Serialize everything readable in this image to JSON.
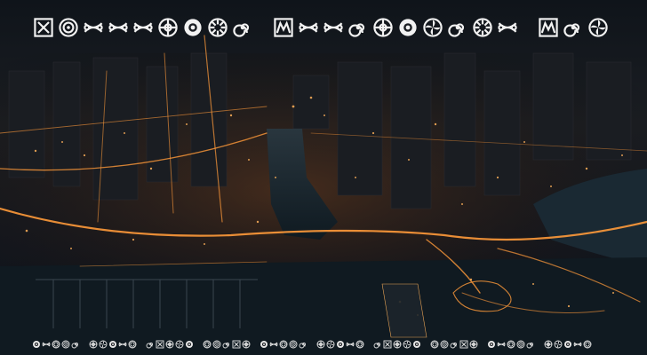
{
  "scene": {
    "description_icon": "city-at-night-photo",
    "colors": {
      "sky": "#111820",
      "water": "#1b2a33",
      "lights": "#ff9f3a",
      "bright_lights": "#ffd08a",
      "blocks": "#161b22"
    }
  },
  "title": {
    "glyphs": [
      "box-x-icon",
      "concentric-circle-icon",
      "knot-icon",
      "knot-icon",
      "knot-icon",
      "flower-icon",
      "sun-icon",
      "sunflower-icon",
      "spiral-icon",
      "space",
      "box-m-icon",
      "knot-icon",
      "knot-icon",
      "spiral-icon",
      "flower-icon",
      "sun-icon",
      "pinwheel-icon",
      "spiral-icon",
      "sunflower-icon",
      "knot-icon",
      "space",
      "box-m-icon",
      "spiral-icon",
      "pinwheel-icon"
    ],
    "color": "#f2f2f2"
  },
  "footer": {
    "glyph_count": 60,
    "color": "#e6e6e6"
  }
}
